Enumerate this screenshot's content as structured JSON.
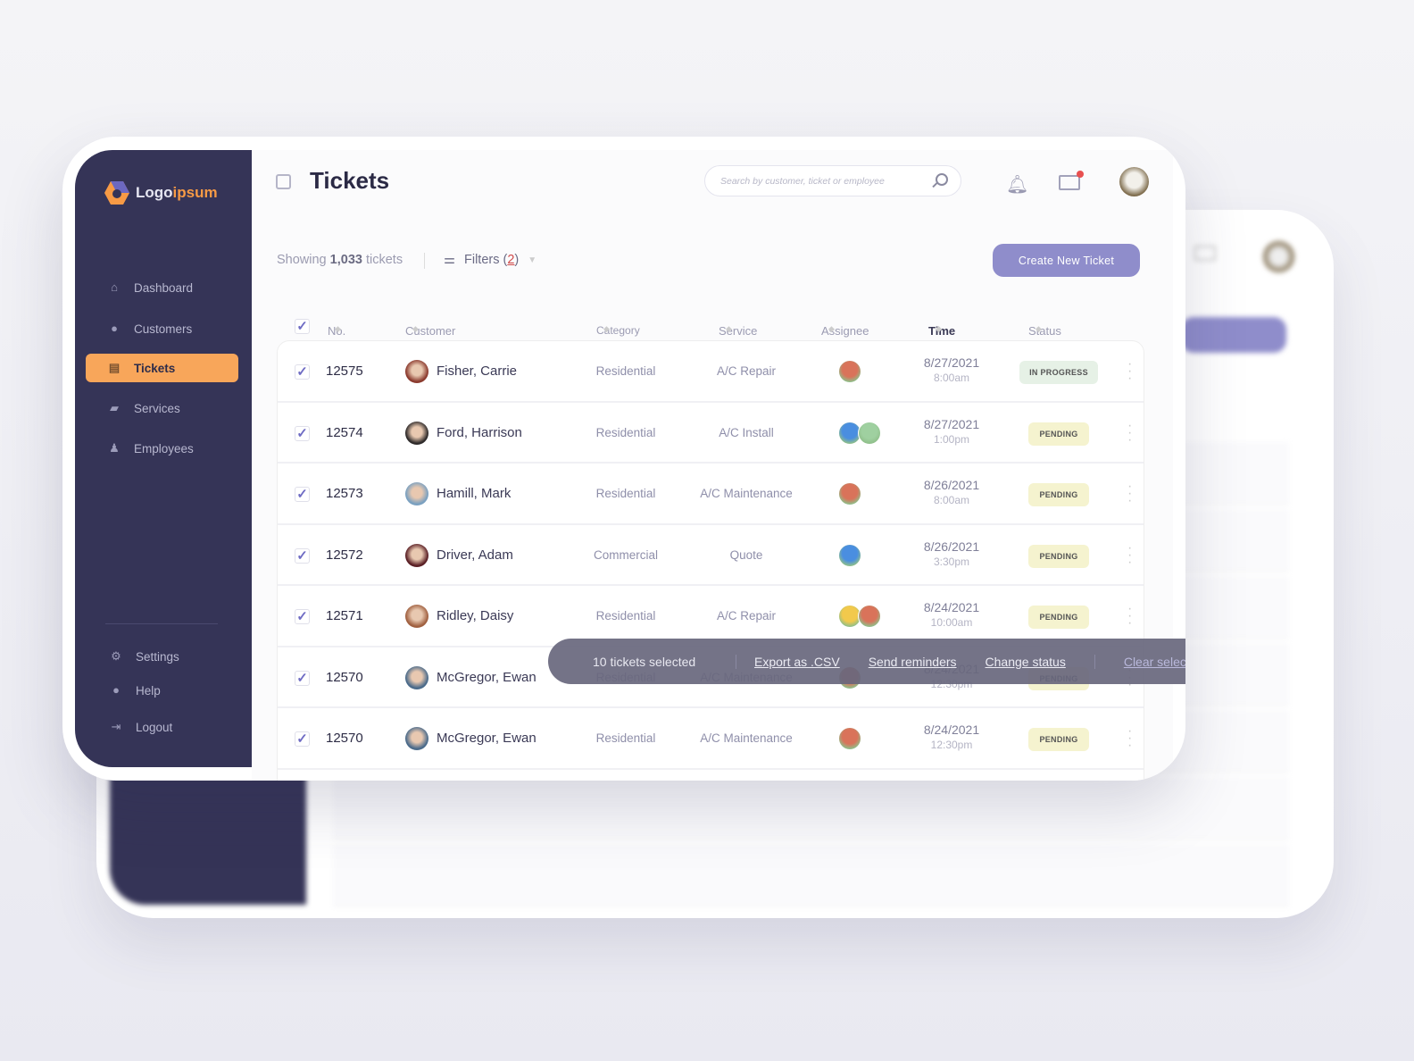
{
  "app": {
    "logo_main": "Logo",
    "logo_accent": "ipsum"
  },
  "sidebar": {
    "items": [
      {
        "label": "Dashboard",
        "icon": "home-icon"
      },
      {
        "label": "Customers",
        "icon": "users-icon"
      },
      {
        "label": "Tickets",
        "icon": "ticket-icon",
        "active": true
      },
      {
        "label": "Services",
        "icon": "folder-icon"
      },
      {
        "label": "Employees",
        "icon": "employee-icon"
      }
    ],
    "bottom": [
      {
        "label": "Settings",
        "icon": "gear-icon"
      },
      {
        "label": "Help",
        "icon": "help-icon"
      },
      {
        "label": "Logout",
        "icon": "logout-icon"
      }
    ]
  },
  "header": {
    "title": "Tickets",
    "search_placeholder": "Search by customer, ticket or employee",
    "mail_unread": true
  },
  "toolbar": {
    "showing_prefix": "Showing",
    "showing_count": "1,033",
    "showing_suffix": "tickets",
    "filters_label": "Filters (",
    "filters_count": "2",
    "filters_close": ")",
    "create_label": "Create New Ticket"
  },
  "table": {
    "columns": [
      "No.",
      "Customer",
      "Category",
      "Service",
      "Assignee",
      "Time",
      "Status"
    ],
    "rows": [
      {
        "no": "12575",
        "customer": "Fisher, Carrie",
        "category": "Residential",
        "service": "A/C Repair",
        "date": "8/27/2021",
        "time": "8:00am",
        "status": "IN PROGRESS",
        "assignees": 1
      },
      {
        "no": "12574",
        "customer": "Ford, Harrison",
        "category": "Residential",
        "service": "A/C Install",
        "date": "8/27/2021",
        "time": "1:00pm",
        "status": "PENDING",
        "assignees": 2
      },
      {
        "no": "12573",
        "customer": "Hamill, Mark",
        "category": "Residential",
        "service": "A/C Maintenance",
        "date": "8/26/2021",
        "time": "8:00am",
        "status": "PENDING",
        "assignees": 1
      },
      {
        "no": "12572",
        "customer": "Driver, Adam",
        "category": "Commercial",
        "service": "Quote",
        "date": "8/26/2021",
        "time": "3:30pm",
        "status": "PENDING",
        "assignees": 1
      },
      {
        "no": "12571",
        "customer": "Ridley, Daisy",
        "category": "Residential",
        "service": "A/C Repair",
        "date": "8/24/2021",
        "time": "10:00am",
        "status": "PENDING",
        "assignees": 2
      },
      {
        "no": "12570",
        "customer": "McGregor, Ewan",
        "category": "Residential",
        "service": "A/C Maintenance",
        "date": "8/24/2021",
        "time": "12:30pm",
        "status": "PENDING",
        "assignees": 1
      },
      {
        "no": "12570",
        "customer": "McGregor, Ewan",
        "category": "Residential",
        "service": "A/C Maintenance",
        "date": "8/24/2021",
        "time": "12:30pm",
        "status": "PENDING",
        "assignees": 1
      }
    ]
  },
  "selection_bar": {
    "count_label": "10 tickets selected",
    "actions": [
      "Export as .CSV",
      "Send reminders",
      "Change status"
    ],
    "clear_label": "Clear selections"
  },
  "colors": {
    "sidebar": "#353457",
    "accent": "#f8a65a",
    "primary": "#8f8dcb",
    "in_progress": "#e6f1e6",
    "pending": "#f5f3cf"
  }
}
